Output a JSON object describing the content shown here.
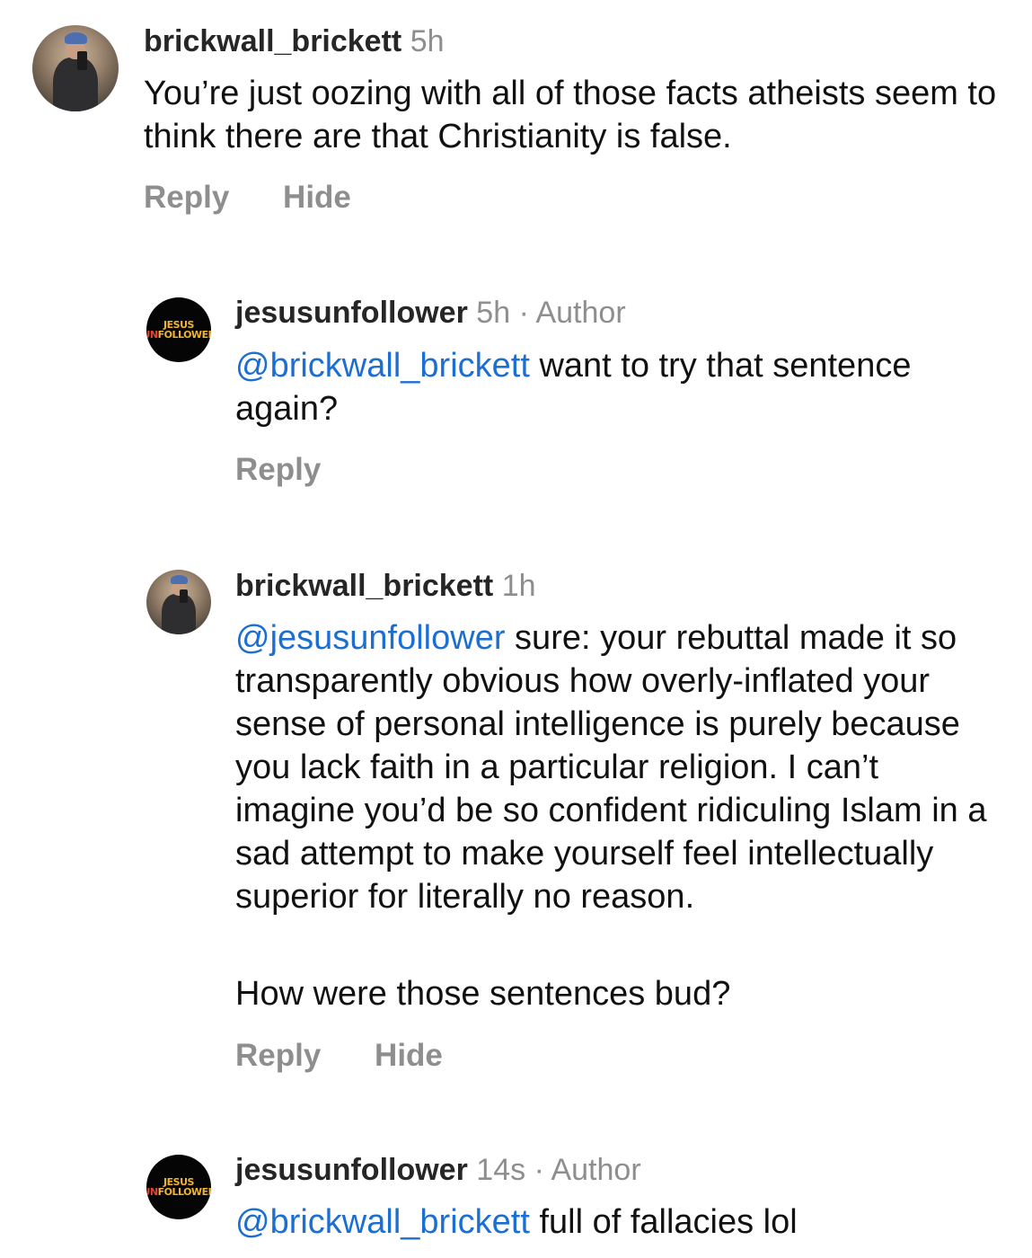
{
  "comments": [
    {
      "username": "brickwall_brickett",
      "time": "5h",
      "text": "You’re just oozing with all of those facts atheists seem to think there are that Christianity is false.",
      "actions": [
        "Reply",
        "Hide"
      ]
    },
    {
      "username": "jesusunfollower",
      "time": "5h",
      "separator": "·",
      "author_label": "Author",
      "mention": "@brickwall_brickett",
      "text": " want to try that sentence again?",
      "actions": [
        "Reply"
      ]
    },
    {
      "username": "brickwall_brickett",
      "time": "1h",
      "mention": "@jesusunfollower",
      "text": " sure: your rebuttal made it so transparently obvious how overly-inflated your sense of personal intelligence is purely because you lack faith in a particular religion. I can’t imagine you’d be so confident ridiculing Islam in a sad attempt to make yourself feel intellectually superior for literally no reason.",
      "text2": "How were those sentences bud?",
      "actions": [
        "Reply",
        "Hide"
      ]
    },
    {
      "username": "jesusunfollower",
      "time": "14s",
      "separator": "·",
      "author_label": "Author",
      "mention": "@brickwall_brickett",
      "text": " full of fallacies lol"
    }
  ],
  "logo": {
    "line1": "JESUS",
    "line2_prefix": "UN",
    "line2_rest": "FOLLOWER"
  }
}
